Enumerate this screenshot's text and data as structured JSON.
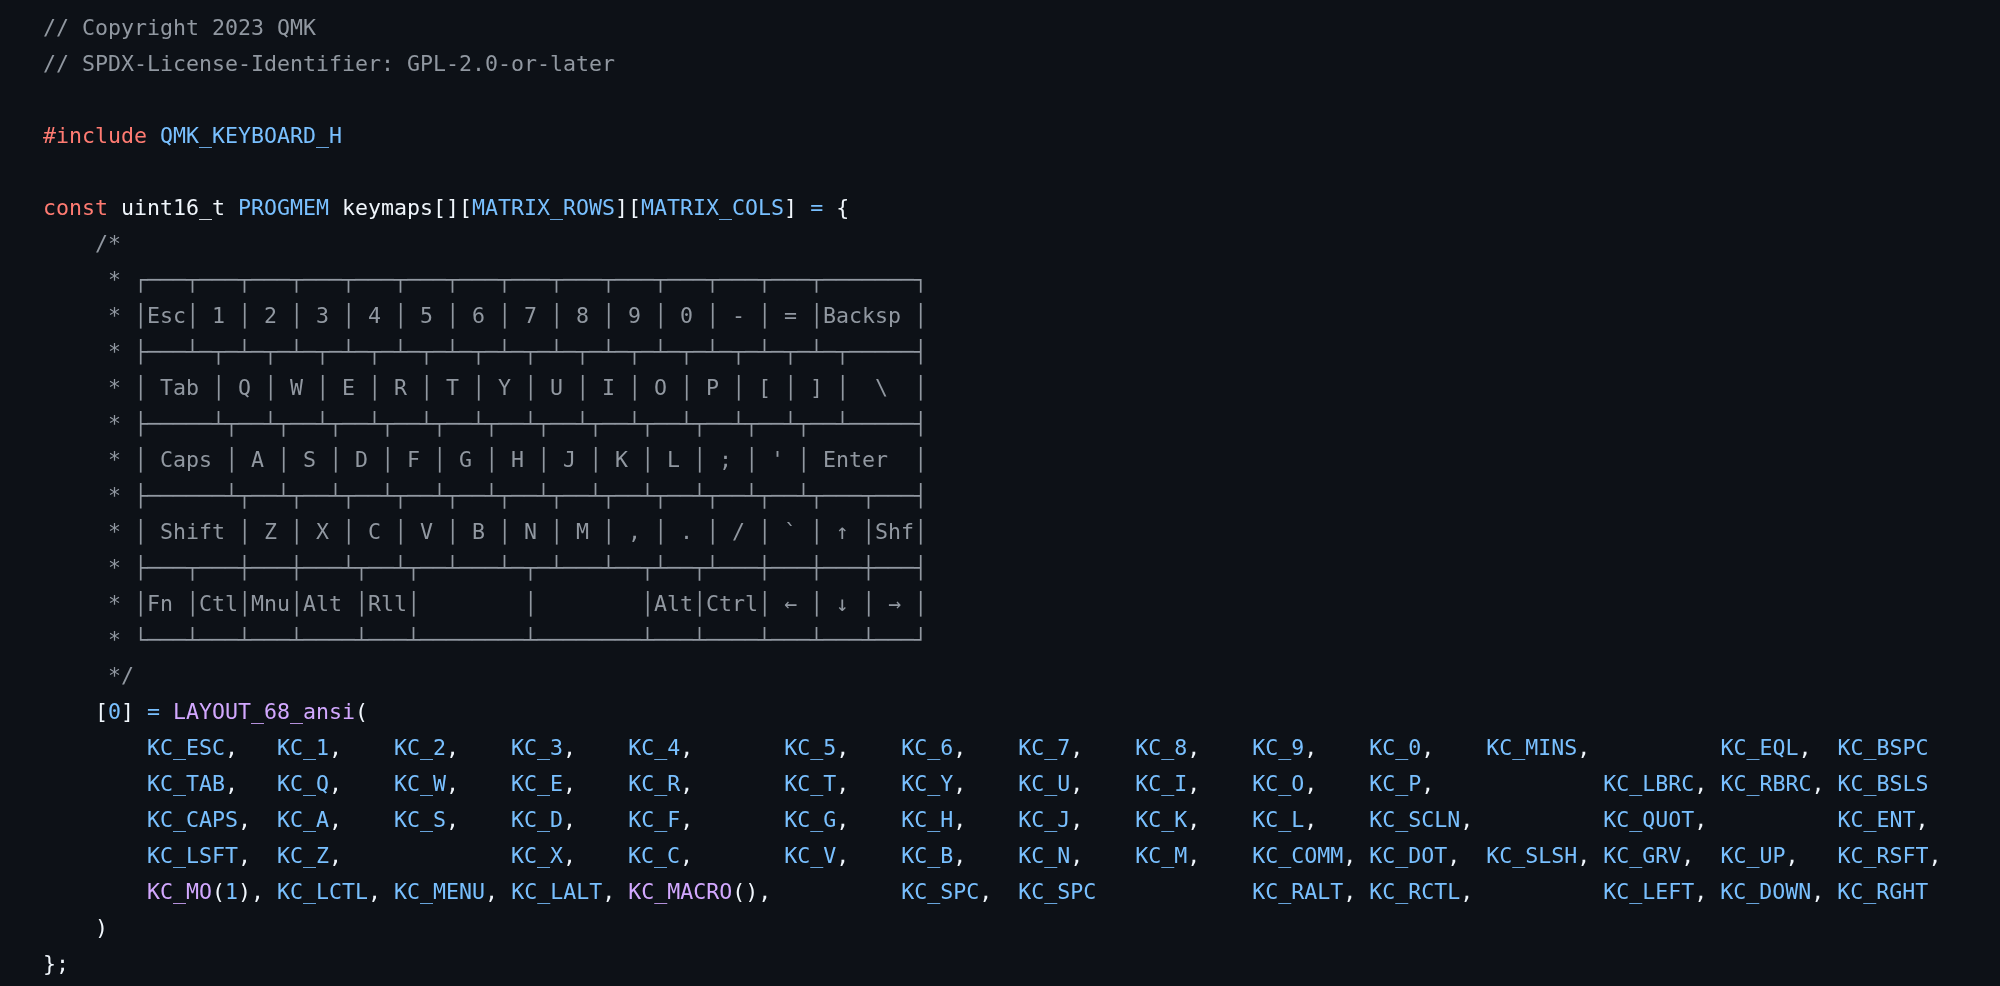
{
  "code_lines": [
    {
      "kind": "code",
      "tokens": [
        {
          "kind": "comment",
          "text": "// Copyright 2023 QMK"
        }
      ]
    },
    {
      "kind": "code",
      "tokens": [
        {
          "kind": "comment",
          "text": "// SPDX-License-Identifier: GPL-2.0-or-later"
        }
      ]
    },
    {
      "kind": "blank"
    },
    {
      "kind": "code",
      "tokens": [
        {
          "kind": "keyword",
          "text": "#include"
        },
        {
          "kind": "constant",
          "text": " QMK_KEYBOARD_H"
        }
      ]
    },
    {
      "kind": "blank"
    },
    {
      "kind": "code",
      "tokens": [
        {
          "kind": "keyword",
          "text": "const"
        },
        {
          "kind": "plain",
          "text": " uint16_t "
        },
        {
          "kind": "constant",
          "text": "PROGMEM"
        },
        {
          "kind": "plain",
          "text": " keymaps[]["
        },
        {
          "kind": "constant",
          "text": "MATRIX_ROWS"
        },
        {
          "kind": "plain",
          "text": "]["
        },
        {
          "kind": "constant",
          "text": "MATRIX_COLS"
        },
        {
          "kind": "plain",
          "text": "] "
        },
        {
          "kind": "constant",
          "text": "="
        },
        {
          "kind": "plain",
          "text": " {"
        }
      ]
    },
    {
      "kind": "code",
      "tokens": [
        {
          "kind": "comment",
          "text": "    /*"
        }
      ]
    },
    {
      "kind": "code",
      "tokens": [
        {
          "kind": "comment",
          "text": "     * ┌───┬───┬───┬───┬───┬───┬───┬───┬───┬───┬───┬───┬───┬───────┐"
        }
      ]
    },
    {
      "kind": "code",
      "tokens": [
        {
          "kind": "comment",
          "text": "     * │Esc│ 1 │ 2 │ 3 │ 4 │ 5 │ 6 │ 7 │ 8 │ 9 │ 0 │ - │ = │Backsp │"
        }
      ]
    },
    {
      "kind": "code",
      "tokens": [
        {
          "kind": "comment",
          "text": "     * ├───┴─┬─┴─┬─┴─┬─┴─┬─┴─┬─┴─┬─┴─┬─┴─┬─┴─┬─┴─┬─┴─┬─┴─┬─┴─┬─────┤"
        }
      ]
    },
    {
      "kind": "code",
      "tokens": [
        {
          "kind": "comment",
          "text": "     * │ Tab │ Q │ W │ E │ R │ T │ Y │ U │ I │ O │ P │ [ │ ] │  \\  │"
        }
      ]
    },
    {
      "kind": "code",
      "tokens": [
        {
          "kind": "comment",
          "text": "     * ├─────┴┬──┴┬──┴┬──┴┬──┴┬──┴┬──┴┬──┴┬──┴┬──┴┬──┴┬──┴┬──┴─────┤"
        }
      ]
    },
    {
      "kind": "code",
      "tokens": [
        {
          "kind": "comment",
          "text": "     * │ Caps │ A │ S │ D │ F │ G │ H │ J │ K │ L │ ; │ ' │ Enter  │"
        }
      ]
    },
    {
      "kind": "code",
      "tokens": [
        {
          "kind": "comment",
          "text": "     * ├──────┴┬──┴┬──┴┬──┴┬──┴┬──┴┬──┴┬──┴┬──┴┬──┴┬──┴┬──┴┬───┬───┤"
        }
      ]
    },
    {
      "kind": "code",
      "tokens": [
        {
          "kind": "comment",
          "text": "     * │ Shift │ Z │ X │ C │ V │ B │ N │ M │ , │ . │ / │ ` │ ↑ │Shf│"
        }
      ]
    },
    {
      "kind": "code",
      "tokens": [
        {
          "kind": "comment",
          "text": "     * ├───┬───┼───┼───┴┬──┴┬──┴───┴─┬─┴───┴──┬┴──┬┴───┼───┼───┼───┤"
        }
      ]
    },
    {
      "kind": "code",
      "tokens": [
        {
          "kind": "comment",
          "text": "     * │Fn │Ctl│Mnu│Alt │Rll│        │        │Alt│Ctrl│ ← │ ↓ │ → │"
        }
      ]
    },
    {
      "kind": "code",
      "tokens": [
        {
          "kind": "comment",
          "text": "     * └───┴───┴───┴────┴───┴────────┴────────┴───┴────┴───┴───┴───┘"
        }
      ]
    },
    {
      "kind": "code",
      "tokens": [
        {
          "kind": "comment",
          "text": "     */"
        }
      ]
    },
    {
      "kind": "code",
      "tokens": [
        {
          "kind": "plain",
          "text": "    ["
        },
        {
          "kind": "constant",
          "text": "0"
        },
        {
          "kind": "plain",
          "text": "] "
        },
        {
          "kind": "constant",
          "text": "="
        },
        {
          "kind": "function",
          "text": " LAYOUT_68_ansi"
        },
        {
          "kind": "plain",
          "text": "("
        }
      ]
    },
    {
      "kind": "code",
      "tokens": [
        {
          "kind": "constant",
          "text": "        KC_ESC"
        },
        {
          "kind": "plain",
          "text": ",   "
        },
        {
          "kind": "constant",
          "text": "KC_1"
        },
        {
          "kind": "plain",
          "text": ",    "
        },
        {
          "kind": "constant",
          "text": "KC_2"
        },
        {
          "kind": "plain",
          "text": ",    "
        },
        {
          "kind": "constant",
          "text": "KC_3"
        },
        {
          "kind": "plain",
          "text": ",    "
        },
        {
          "kind": "constant",
          "text": "KC_4"
        },
        {
          "kind": "plain",
          "text": ",       "
        },
        {
          "kind": "constant",
          "text": "KC_5"
        },
        {
          "kind": "plain",
          "text": ",    "
        },
        {
          "kind": "constant",
          "text": "KC_6"
        },
        {
          "kind": "plain",
          "text": ",    "
        },
        {
          "kind": "constant",
          "text": "KC_7"
        },
        {
          "kind": "plain",
          "text": ",    "
        },
        {
          "kind": "constant",
          "text": "KC_8"
        },
        {
          "kind": "plain",
          "text": ",    "
        },
        {
          "kind": "constant",
          "text": "KC_9"
        },
        {
          "kind": "plain",
          "text": ",    "
        },
        {
          "kind": "constant",
          "text": "KC_0"
        },
        {
          "kind": "plain",
          "text": ",    "
        },
        {
          "kind": "constant",
          "text": "KC_MINS"
        },
        {
          "kind": "plain",
          "text": ",          "
        },
        {
          "kind": "constant",
          "text": "KC_EQL"
        },
        {
          "kind": "plain",
          "text": ",  "
        },
        {
          "kind": "constant",
          "text": "KC_BSPC"
        }
      ]
    },
    {
      "kind": "code",
      "tokens": [
        {
          "kind": "constant",
          "text": "        KC_TAB"
        },
        {
          "kind": "plain",
          "text": ",   "
        },
        {
          "kind": "constant",
          "text": "KC_Q"
        },
        {
          "kind": "plain",
          "text": ",    "
        },
        {
          "kind": "constant",
          "text": "KC_W"
        },
        {
          "kind": "plain",
          "text": ",    "
        },
        {
          "kind": "constant",
          "text": "KC_E"
        },
        {
          "kind": "plain",
          "text": ",    "
        },
        {
          "kind": "constant",
          "text": "KC_R"
        },
        {
          "kind": "plain",
          "text": ",       "
        },
        {
          "kind": "constant",
          "text": "KC_T"
        },
        {
          "kind": "plain",
          "text": ",    "
        },
        {
          "kind": "constant",
          "text": "KC_Y"
        },
        {
          "kind": "plain",
          "text": ",    "
        },
        {
          "kind": "constant",
          "text": "KC_U"
        },
        {
          "kind": "plain",
          "text": ",    "
        },
        {
          "kind": "constant",
          "text": "KC_I"
        },
        {
          "kind": "plain",
          "text": ",    "
        },
        {
          "kind": "constant",
          "text": "KC_O"
        },
        {
          "kind": "plain",
          "text": ",    "
        },
        {
          "kind": "constant",
          "text": "KC_P"
        },
        {
          "kind": "plain",
          "text": ",             "
        },
        {
          "kind": "constant",
          "text": "KC_LBRC"
        },
        {
          "kind": "plain",
          "text": ", "
        },
        {
          "kind": "constant",
          "text": "KC_RBRC"
        },
        {
          "kind": "plain",
          "text": ", "
        },
        {
          "kind": "constant",
          "text": "KC_BSLS"
        }
      ]
    },
    {
      "kind": "code",
      "tokens": [
        {
          "kind": "constant",
          "text": "        KC_CAPS"
        },
        {
          "kind": "plain",
          "text": ",  "
        },
        {
          "kind": "constant",
          "text": "KC_A"
        },
        {
          "kind": "plain",
          "text": ",    "
        },
        {
          "kind": "constant",
          "text": "KC_S"
        },
        {
          "kind": "plain",
          "text": ",    "
        },
        {
          "kind": "constant",
          "text": "KC_D"
        },
        {
          "kind": "plain",
          "text": ",    "
        },
        {
          "kind": "constant",
          "text": "KC_F"
        },
        {
          "kind": "plain",
          "text": ",       "
        },
        {
          "kind": "constant",
          "text": "KC_G"
        },
        {
          "kind": "plain",
          "text": ",    "
        },
        {
          "kind": "constant",
          "text": "KC_H"
        },
        {
          "kind": "plain",
          "text": ",    "
        },
        {
          "kind": "constant",
          "text": "KC_J"
        },
        {
          "kind": "plain",
          "text": ",    "
        },
        {
          "kind": "constant",
          "text": "KC_K"
        },
        {
          "kind": "plain",
          "text": ",    "
        },
        {
          "kind": "constant",
          "text": "KC_L"
        },
        {
          "kind": "plain",
          "text": ",    "
        },
        {
          "kind": "constant",
          "text": "KC_SCLN"
        },
        {
          "kind": "plain",
          "text": ",          "
        },
        {
          "kind": "constant",
          "text": "KC_QUOT"
        },
        {
          "kind": "plain",
          "text": ",          "
        },
        {
          "kind": "constant",
          "text": "KC_ENT"
        },
        {
          "kind": "plain",
          "text": ","
        }
      ]
    },
    {
      "kind": "code",
      "tokens": [
        {
          "kind": "constant",
          "text": "        KC_LSFT"
        },
        {
          "kind": "plain",
          "text": ",  "
        },
        {
          "kind": "constant",
          "text": "KC_Z"
        },
        {
          "kind": "plain",
          "text": ",             "
        },
        {
          "kind": "constant",
          "text": "KC_X"
        },
        {
          "kind": "plain",
          "text": ",    "
        },
        {
          "kind": "constant",
          "text": "KC_C"
        },
        {
          "kind": "plain",
          "text": ",       "
        },
        {
          "kind": "constant",
          "text": "KC_V"
        },
        {
          "kind": "plain",
          "text": ",    "
        },
        {
          "kind": "constant",
          "text": "KC_B"
        },
        {
          "kind": "plain",
          "text": ",    "
        },
        {
          "kind": "constant",
          "text": "KC_N"
        },
        {
          "kind": "plain",
          "text": ",    "
        },
        {
          "kind": "constant",
          "text": "KC_M"
        },
        {
          "kind": "plain",
          "text": ",    "
        },
        {
          "kind": "constant",
          "text": "KC_COMM"
        },
        {
          "kind": "plain",
          "text": ", "
        },
        {
          "kind": "constant",
          "text": "KC_DOT"
        },
        {
          "kind": "plain",
          "text": ",  "
        },
        {
          "kind": "constant",
          "text": "KC_SLSH"
        },
        {
          "kind": "plain",
          "text": ", "
        },
        {
          "kind": "constant",
          "text": "KC_GRV"
        },
        {
          "kind": "plain",
          "text": ",  "
        },
        {
          "kind": "constant",
          "text": "KC_UP"
        },
        {
          "kind": "plain",
          "text": ",   "
        },
        {
          "kind": "constant",
          "text": "KC_RSFT"
        },
        {
          "kind": "plain",
          "text": ","
        }
      ]
    },
    {
      "kind": "code",
      "tokens": [
        {
          "kind": "function",
          "text": "        KC_MO"
        },
        {
          "kind": "plain",
          "text": "("
        },
        {
          "kind": "constant",
          "text": "1"
        },
        {
          "kind": "plain",
          "text": "), "
        },
        {
          "kind": "constant",
          "text": "KC_LCTL"
        },
        {
          "kind": "plain",
          "text": ", "
        },
        {
          "kind": "constant",
          "text": "KC_MENU"
        },
        {
          "kind": "plain",
          "text": ", "
        },
        {
          "kind": "constant",
          "text": "KC_LALT"
        },
        {
          "kind": "plain",
          "text": ", "
        },
        {
          "kind": "function",
          "text": "KC_MACRO"
        },
        {
          "kind": "plain",
          "text": "(),          "
        },
        {
          "kind": "constant",
          "text": "KC_SPC"
        },
        {
          "kind": "plain",
          "text": ",  "
        },
        {
          "kind": "constant",
          "text": "KC_SPC"
        },
        {
          "kind": "constant",
          "text": "            KC_RALT"
        },
        {
          "kind": "plain",
          "text": ", "
        },
        {
          "kind": "constant",
          "text": "KC_RCTL"
        },
        {
          "kind": "plain",
          "text": ",          "
        },
        {
          "kind": "constant",
          "text": "KC_LEFT"
        },
        {
          "kind": "plain",
          "text": ", "
        },
        {
          "kind": "constant",
          "text": "KC_DOWN"
        },
        {
          "kind": "plain",
          "text": ", "
        },
        {
          "kind": "constant",
          "text": "KC_RGHT"
        }
      ]
    },
    {
      "kind": "code",
      "tokens": [
        {
          "kind": "plain",
          "text": "    )"
        }
      ]
    },
    {
      "kind": "code",
      "tokens": [
        {
          "kind": "plain",
          "text": "};"
        }
      ]
    }
  ]
}
